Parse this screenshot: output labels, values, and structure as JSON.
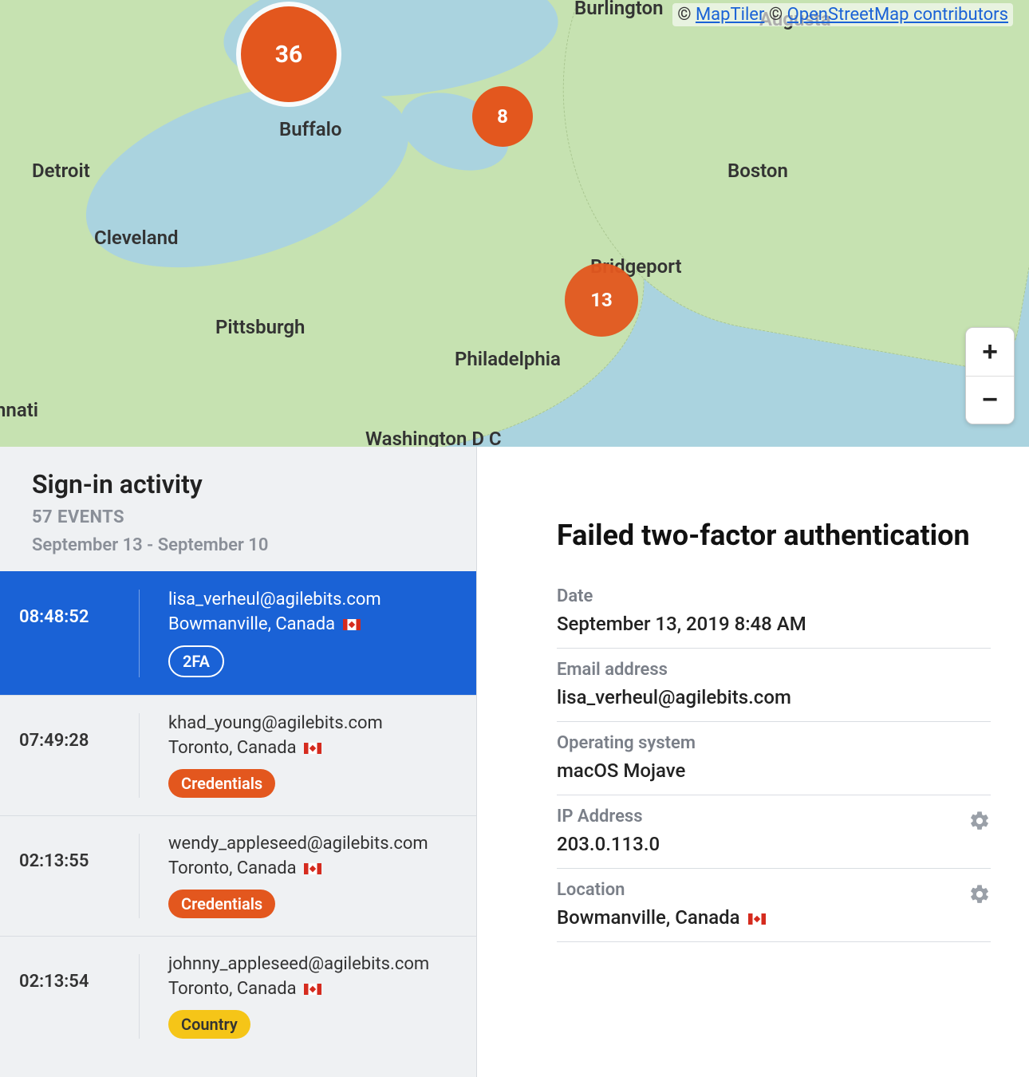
{
  "map": {
    "attribution_prefix": "© ",
    "attribution_maptiler": "MapTiler",
    "attribution_between": "  © ",
    "attribution_osm": "OpenStreetMap contributors",
    "zoom_in_label": "+",
    "zoom_out_label": "−",
    "clusters": {
      "big": "36",
      "med": "8",
      "south": "13"
    },
    "cities": {
      "burlington": "Burlington",
      "augusta": "Augusta",
      "buffalo": "Buffalo",
      "detroit": "Detroit",
      "boston": "Boston",
      "cleveland": "Cleveland",
      "bridgeport": "Bridgeport",
      "pittsburgh": "Pittsburgh",
      "philadelphia": "Philadelphia",
      "cincinnati": "nnati",
      "washington": "Washington D C"
    }
  },
  "left": {
    "title": "Sign-in activity",
    "events_count": "57 EVENTS",
    "date_range": "September 13 - September 10",
    "events": [
      {
        "time": "08:48:52",
        "email": "lisa_verheul@agilebits.com",
        "location": "Bowmanville, Canada",
        "badge_label": "2FA",
        "badge_style": "outline-white",
        "selected": true
      },
      {
        "time": "07:49:28",
        "email": "khad_young@agilebits.com",
        "location": "Toronto, Canada",
        "badge_label": "Credentials",
        "badge_style": "orange",
        "selected": false
      },
      {
        "time": "02:13:55",
        "email": "wendy_appleseed@agilebits.com",
        "location": "Toronto, Canada",
        "badge_label": "Credentials",
        "badge_style": "orange",
        "selected": false
      },
      {
        "time": "02:13:54",
        "email": "johnny_appleseed@agilebits.com",
        "location": "Toronto, Canada",
        "badge_label": "Country",
        "badge_style": "yellow",
        "selected": false
      }
    ]
  },
  "detail": {
    "title": "Failed two-factor authentication",
    "rows": [
      {
        "label": "Date",
        "value": "September 13, 2019 8:48 AM",
        "gear": false,
        "flag": false
      },
      {
        "label": "Email address",
        "value": "lisa_verheul@agilebits.com",
        "gear": false,
        "flag": false
      },
      {
        "label": "Operating system",
        "value": "macOS Mojave",
        "gear": false,
        "flag": false
      },
      {
        "label": "IP Address",
        "value": "203.0.113.0",
        "gear": true,
        "flag": false
      },
      {
        "label": "Location",
        "value": "Bowmanville, Canada",
        "gear": true,
        "flag": true
      }
    ]
  }
}
